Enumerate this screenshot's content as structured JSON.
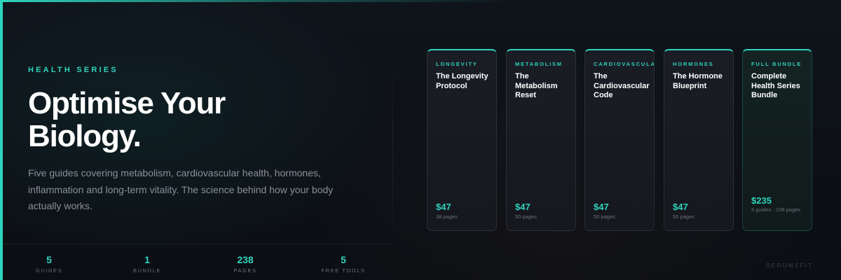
{
  "hero": {
    "eyebrow": "HEALTH SERIES",
    "headline_line1": "Optimise Your",
    "headline_line2": "Biology.",
    "description": "Five guides covering metabolism, cardiovascular health, hormones, inflammation and long-term vitality. The science behind how your body actually works."
  },
  "stats": [
    {
      "value": "5",
      "label": "GUIDES"
    },
    {
      "value": "1",
      "label": "BUNDLE"
    },
    {
      "value": "238",
      "label": "PAGES"
    },
    {
      "value": "5",
      "label": "FREE TOOLS"
    }
  ],
  "cards": [
    {
      "category": "LONGEVITY",
      "title": "The Longevity Protocol",
      "price": "$47",
      "meta": "38 pages"
    },
    {
      "category": "METABOLISM",
      "title": "The Metabolism Reset",
      "price": "$47",
      "meta": "50 pages"
    },
    {
      "category": "CARDIOVASCULAR",
      "title": "The Cardiovascular Code",
      "price": "$47",
      "meta": "50 pages"
    },
    {
      "category": "HORMONES",
      "title": "The Hormone Blueprint",
      "price": "$47",
      "meta": "50 pages"
    },
    {
      "category": "FULL BUNDLE",
      "title": "Complete Health Series Bundle",
      "price": "$235",
      "meta": "5 guides · 238 pages"
    }
  ],
  "brand": "SERUMSFIT",
  "colors": {
    "accent": "#2ed3bc",
    "background": "#0d1016",
    "card_background": "#1a1d24",
    "text_primary": "#ffffff",
    "text_secondary": "#8a8f98"
  }
}
